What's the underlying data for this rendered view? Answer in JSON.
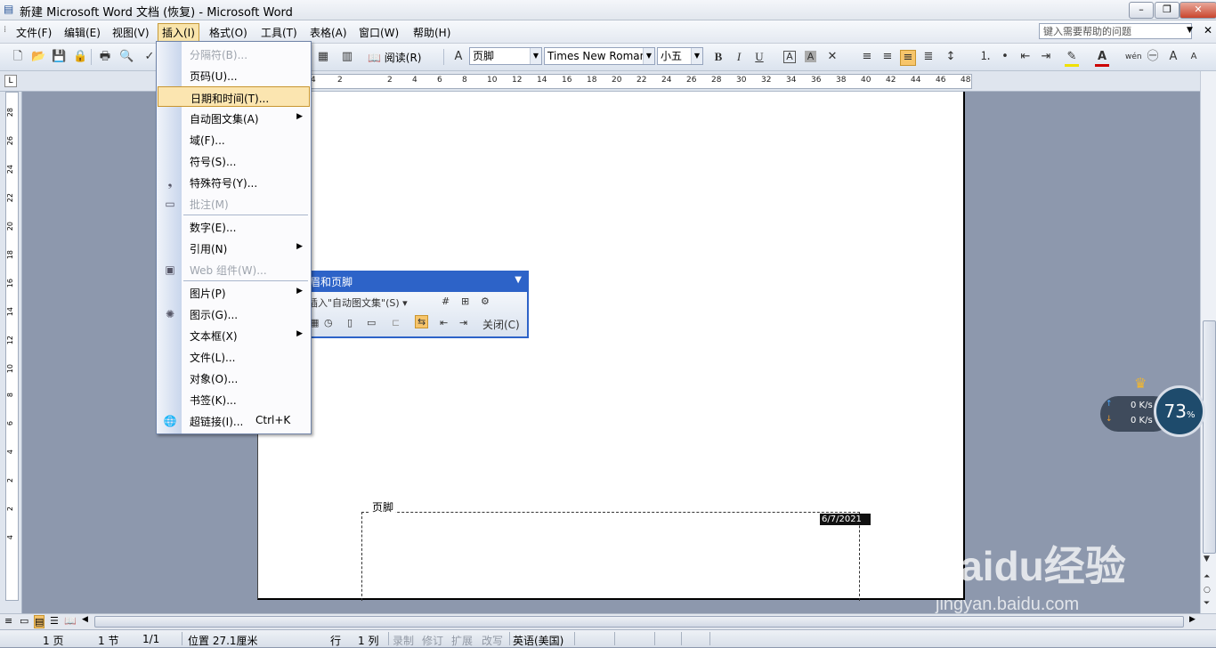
{
  "titlebar": {
    "title": "新建 Microsoft Word 文档 (恢复) - Microsoft Word",
    "min": "–",
    "max": "❐",
    "close": "✕"
  },
  "menubar": {
    "items": [
      "文件(F)",
      "编辑(E)",
      "视图(V)",
      "插入(I)",
      "格式(O)",
      "工具(T)",
      "表格(A)",
      "窗口(W)",
      "帮助(H)"
    ],
    "help_placeholder": "键入需要帮助的问题"
  },
  "toolbar": {
    "read_label": "阅读(R)",
    "style": "页脚",
    "font": "Times New Roman",
    "size": "小五"
  },
  "ruler": {
    "numbers": [
      "4",
      "2",
      "2",
      "4",
      "6",
      "8",
      "10",
      "12",
      "14",
      "16",
      "18",
      "20",
      "22",
      "24",
      "26",
      "28",
      "30",
      "32",
      "34",
      "36",
      "38",
      "40",
      "42",
      "44",
      "46",
      "48"
    ]
  },
  "vruler": {
    "numbers": [
      "28",
      "26",
      "24",
      "22",
      "20",
      "18",
      "16",
      "14",
      "12",
      "10",
      "8",
      "6",
      "4",
      "2",
      "2",
      "4"
    ]
  },
  "insert_menu": {
    "items": [
      {
        "label": "分隔符(B)...",
        "disabled": true
      },
      {
        "label": "页码(U)..."
      },
      {
        "label": "日期和时间(T)...",
        "highlight": true
      },
      {
        "label": "自动图文集(A)",
        "submenu": true
      },
      {
        "label": "域(F)..."
      },
      {
        "label": "符号(S)..."
      },
      {
        "label": "特殊符号(Y)..."
      },
      {
        "label": "批注(M)",
        "disabled": true
      },
      {
        "label": "数字(E)..."
      },
      {
        "label": "引用(N)",
        "submenu": true
      },
      {
        "label": "Web 组件(W)...",
        "disabled": true
      },
      {
        "label": "图片(P)",
        "submenu": true
      },
      {
        "label": "图示(G)..."
      },
      {
        "label": "文本框(X)",
        "submenu": true
      },
      {
        "label": "文件(L)..."
      },
      {
        "label": "对象(O)..."
      },
      {
        "label": "书签(K)..."
      },
      {
        "label": "超链接(I)...",
        "shortcut": "Ctrl+K"
      }
    ]
  },
  "hf_toolbar": {
    "title": "眉和页脚",
    "insert_autotext": "插入\"自动图文集\"(S)",
    "close": "关闭(C)"
  },
  "document": {
    "footer_label": "页脚",
    "date_field": "6/7/2021"
  },
  "statusbar": {
    "page": "1 页",
    "section": "1 节",
    "pages": "1/1",
    "position": "位置 27.1厘米",
    "line": "行",
    "col": "1 列",
    "rec": "录制",
    "trk": "修订",
    "ext": "扩展",
    "ovr": "改写",
    "lang": "英语(美国)"
  },
  "net_widget": {
    "up": "0 K/s",
    "down": "0 K/s",
    "percent": "73",
    "percent_sign": "%"
  },
  "watermark": {
    "brand": "Baidu经验",
    "url": "jingyan.baidu.com"
  }
}
